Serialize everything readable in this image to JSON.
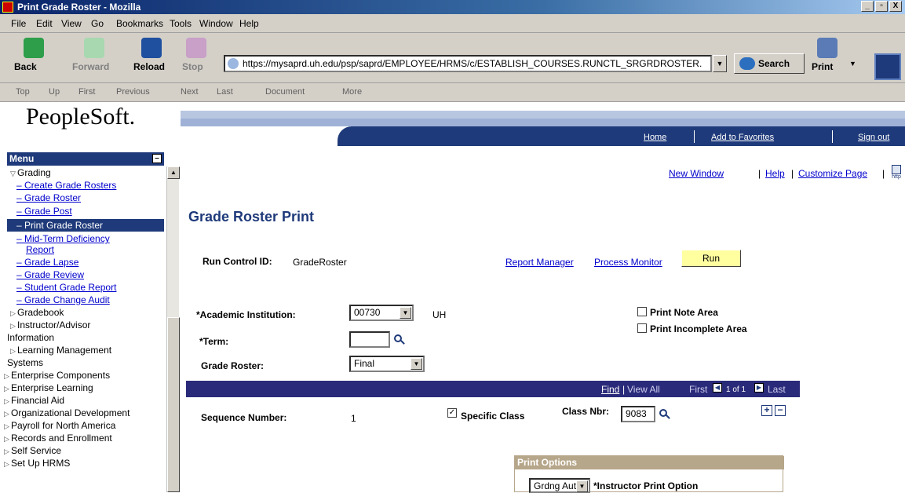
{
  "window": {
    "title": "Print Grade Roster - Mozilla",
    "controls": [
      "_",
      "▫",
      "X"
    ]
  },
  "menubar": [
    "File",
    "Edit",
    "View",
    "Go",
    "Bookmarks",
    "Tools",
    "Window",
    "Help"
  ],
  "toolbar": {
    "back": "Back",
    "forward": "Forward",
    "reload": "Reload",
    "stop": "Stop",
    "url": "https://mysaprd.uh.edu/psp/saprd/EMPLOYEE/HRMS/c/ESTABLISH_COURSES.RUNCTL_SRGRDROSTER.",
    "search": "Search",
    "print": "Print"
  },
  "sitenav": [
    "Top",
    "Up",
    "First",
    "Previous",
    "Next",
    "Last",
    "Document",
    "More"
  ],
  "brand": {
    "logo": "PeopleSoft."
  },
  "header_links": [
    "Home",
    "Add to Favorites",
    "Sign out"
  ],
  "left_menu": {
    "title": "Menu",
    "items": [
      {
        "label": "Grading",
        "type": "expanded"
      },
      {
        "label": "– Create Grade Rosters",
        "type": "link"
      },
      {
        "label": "– Grade Roster",
        "type": "link"
      },
      {
        "label": "– Grade Post",
        "type": "link"
      },
      {
        "label": "– Print Grade Roster",
        "type": "selected"
      },
      {
        "label": "– Mid-Term Deficiency",
        "type": "link"
      },
      {
        "label": "Report",
        "type": "link"
      },
      {
        "label": "– Grade Lapse",
        "type": "link"
      },
      {
        "label": "– Grade Review",
        "type": "link"
      },
      {
        "label": "– Student Grade Report",
        "type": "link"
      },
      {
        "label": "– Grade Change Audit",
        "type": "link"
      },
      {
        "label": "Gradebook",
        "type": "folder"
      },
      {
        "label": "Instructor/Advisor",
        "type": "folder"
      },
      {
        "label": "Information",
        "type": "plain"
      },
      {
        "label": "Learning Management",
        "type": "folder"
      },
      {
        "label": "Systems",
        "type": "plain"
      },
      {
        "label": "Enterprise Components",
        "type": "folder0"
      },
      {
        "label": "Enterprise Learning",
        "type": "folder0"
      },
      {
        "label": "Financial Aid",
        "type": "folder0"
      },
      {
        "label": "Organizational Development",
        "type": "folder0"
      },
      {
        "label": "Payroll for North America",
        "type": "folder0"
      },
      {
        "label": "Records and Enrollment",
        "type": "folder0"
      },
      {
        "label": "Self Service",
        "type": "folder0"
      },
      {
        "label": "Set Up HRMS",
        "type": "folder0"
      }
    ]
  },
  "page_links": {
    "new_window": "New Window",
    "help": "Help",
    "customize": "Customize Page",
    "sep": "|",
    "http": "http"
  },
  "page": {
    "title": "Grade Roster Print",
    "run_control_label": "Run Control ID:",
    "run_control_value": "GradeRoster",
    "report_manager": "Report Manager",
    "process_monitor": "Process Monitor",
    "run": "Run",
    "institution_label": "*Academic Institution:",
    "institution_value": "00730",
    "institution_desc": "UH",
    "term_label": "*Term:",
    "term_value": "",
    "roster_label": "Grade Roster:",
    "roster_value": "Final",
    "print_note": "Print Note Area",
    "print_incomplete": "Print Incomplete Area",
    "find": "Find",
    "view_all": "View All",
    "first": "First",
    "page_count": "1 of 1",
    "last": "Last",
    "sequence_label": "Sequence Number:",
    "sequence_value": "1",
    "specific_class": "Specific Class",
    "class_nbr_label": "Class Nbr:",
    "class_nbr_value": "9083",
    "print_options": "Print Options",
    "grdng_auth": "Grdng Auth",
    "instructor_print": "*Instructor Print Option"
  }
}
